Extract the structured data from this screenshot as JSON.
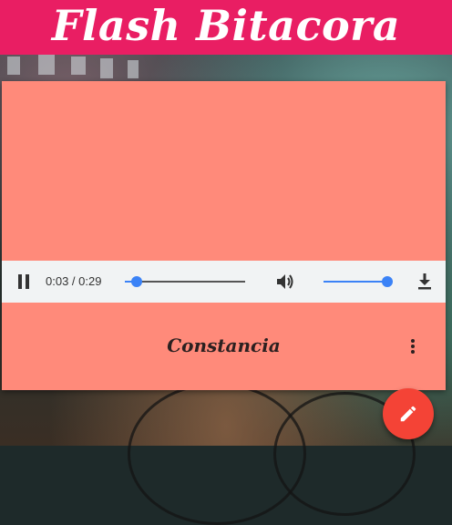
{
  "header": {
    "title": "Flash Bitacora",
    "color": "#e91e63"
  },
  "card": {
    "background": "#ff8a7a",
    "caption": "Constancia",
    "menu_icon": "more-vert-icon"
  },
  "audio_player": {
    "state_icon": "pause-icon",
    "current_time": "0:03",
    "separator": " / ",
    "duration": "0:29",
    "progress_fraction": 0.1,
    "volume_icon": "volume-up-icon",
    "volume_fraction": 1.0,
    "download_icon": "download-icon"
  },
  "fab": {
    "icon": "edit-pencil-icon",
    "color": "#f44336"
  }
}
